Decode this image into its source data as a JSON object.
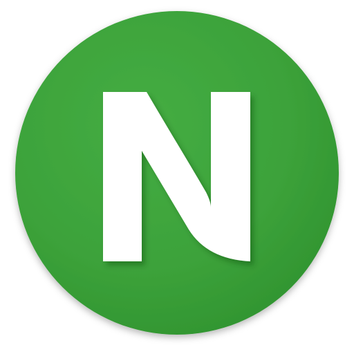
{
  "icon": {
    "name": "app-icon",
    "glyph": "N",
    "colors": {
      "background": "#3a9d3a",
      "background_light": "#45ad43",
      "background_dark": "#2f922f",
      "glyph": "#ffffff",
      "page": "#ffffff"
    }
  }
}
